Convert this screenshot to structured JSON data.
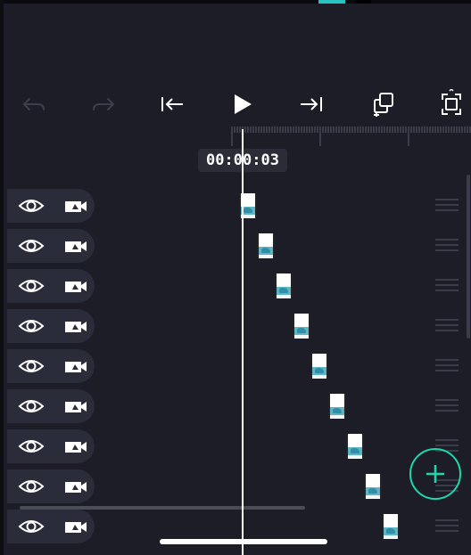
{
  "timecode": "00:00:03",
  "tracks": [
    {
      "clip_index": 0
    },
    {
      "clip_index": 1
    },
    {
      "clip_index": 2
    },
    {
      "clip_index": 3
    },
    {
      "clip_index": 4
    },
    {
      "clip_index": 5
    },
    {
      "clip_index": 6
    },
    {
      "clip_index": 7
    },
    {
      "clip_index": 8
    }
  ],
  "colors": {
    "background": "#1c1d27",
    "accent": "#20d7ad",
    "track_header": "#2a2c39"
  },
  "icons": {
    "undo": "undo-icon",
    "redo": "redo-icon",
    "skip_start": "skip-to-start-icon",
    "play": "play-icon",
    "skip_end": "skip-to-end-icon",
    "copy": "copy-icon",
    "fit": "fit-screen-icon",
    "visibility": "eye-icon",
    "camera": "camera-icon",
    "add": "plus-icon"
  }
}
